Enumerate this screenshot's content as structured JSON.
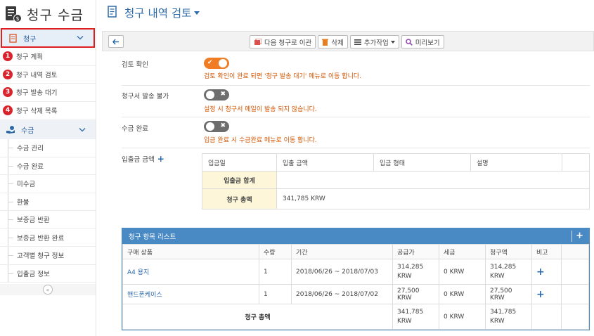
{
  "app": {
    "title": "청구 수금"
  },
  "sidebar": {
    "section_billing": {
      "label": "청구"
    },
    "billing_items": [
      {
        "num": "1",
        "label": "청구 계획"
      },
      {
        "num": "2",
        "label": "청구 내역 검토"
      },
      {
        "num": "3",
        "label": "청구 발송 대기"
      },
      {
        "num": "4",
        "label": "청구 삭제 목록"
      }
    ],
    "section_collection": {
      "label": "수금"
    },
    "collection_items": [
      {
        "label": "수금 관리"
      },
      {
        "label": "수금 완료"
      },
      {
        "label": "미수금"
      },
      {
        "label": "환불"
      },
      {
        "label": "보증금 반환"
      },
      {
        "label": "보증금 반환 완료"
      },
      {
        "label": "고객별 청구 정보"
      },
      {
        "label": "입출금 정보"
      }
    ],
    "collapse_glyph": "«"
  },
  "page": {
    "title": "청구 내역 검토"
  },
  "toolbar": {
    "next_label": "다음 청구로 이관",
    "delete_label": "삭제",
    "more_label": "추가작업",
    "preview_label": "미리보기"
  },
  "form": {
    "review": {
      "label": "검토 확인",
      "state": "on",
      "hint": "검토 확인이 완료 되면 '청구 발송 대기' 메뉴로 이동 합니다."
    },
    "no_send": {
      "label": "청구서 발송 불가",
      "state": "off",
      "hint": "설정 시 청구서 메일이 발송 되지 않습니다."
    },
    "collected": {
      "label": "수금 완료",
      "state": "off",
      "hint": "입금 완료 시 수금완료 메뉴로 이동 합니다."
    }
  },
  "payments": {
    "label": "입출금 금액",
    "headers": [
      "입금일",
      "입출 금액",
      "입금 형태",
      "설명"
    ],
    "sum_label": "입출금 합계",
    "sum_value": "",
    "total_label": "청구 총액",
    "total_value": "341,785 KRW"
  },
  "items": {
    "panel_title": "청구 항목 리스트",
    "headers": [
      "구매 상품",
      "수량",
      "기간",
      "공급가",
      "세금",
      "청구액",
      "비고"
    ],
    "rows": [
      {
        "name": "A4 용지",
        "qty": "1",
        "period": "2018/06/26 ~ 2018/07/03",
        "supply": "314,285 KRW",
        "tax": "0 KRW",
        "charge": "314,285 KRW"
      },
      {
        "name": "핸드폰케이스",
        "qty": "1",
        "period": "2018/06/26 ~ 2018/07/02",
        "supply": "27,500 KRW",
        "tax": "0 KRW",
        "charge": "27,500 KRW"
      }
    ],
    "total": {
      "label": "청구 총액",
      "supply": "341,785 KRW",
      "tax": "0 KRW",
      "charge": "341,785 KRW"
    }
  },
  "colors": {
    "accent": "#2d6aa8",
    "toggle_on": "#f07c23",
    "warning_text": "#d35400",
    "badge_red": "#d9232d",
    "panel_blue": "#4a8ac4"
  }
}
